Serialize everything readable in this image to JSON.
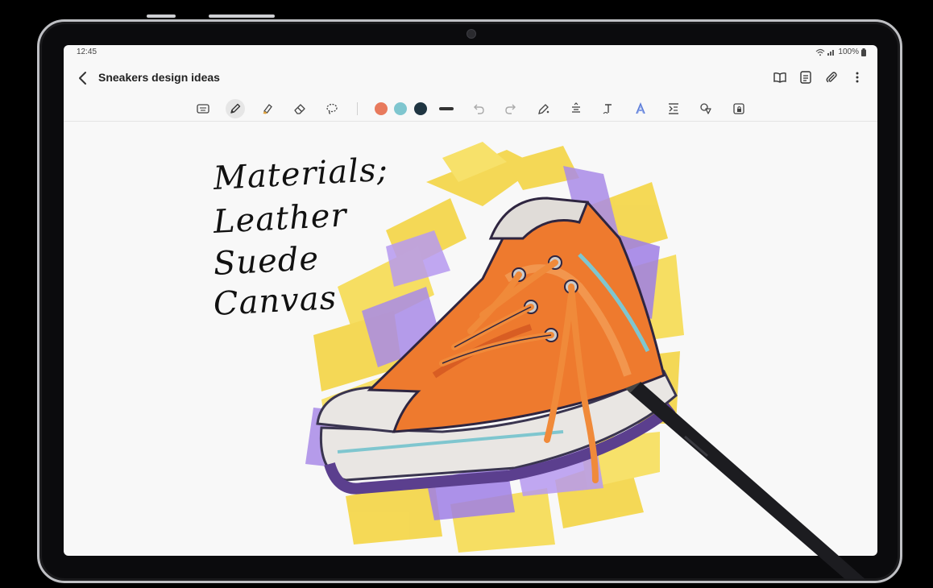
{
  "status_bar": {
    "time": "12:45",
    "battery": "100%"
  },
  "app_bar": {
    "back_icon": "back-arrow-icon",
    "title": "Sneakers design ideas",
    "actions": [
      "book-view-icon",
      "text-page-icon",
      "attachment-icon",
      "more-options-icon"
    ]
  },
  "toolbar": {
    "tools": [
      "keyboard-mode-icon",
      "pen-icon",
      "highlighter-icon",
      "eraser-icon",
      "lasso-select-icon"
    ],
    "active_tool": "pen-icon",
    "colors": [
      "#e87a5d",
      "#7fc6cf",
      "#1f3542"
    ],
    "edit_actions": [
      "undo-icon",
      "redo-icon",
      "pen-settings-icon",
      "text-align-icon",
      "text-style-icon",
      "text-effect-icon",
      "insert-space-icon",
      "shapes-icon",
      "lock-icon"
    ]
  },
  "canvas": {
    "handwriting": [
      "Materials;",
      "Leather",
      "Suede",
      "Canvas"
    ],
    "illustration": "orange-sneaker-artwork"
  }
}
